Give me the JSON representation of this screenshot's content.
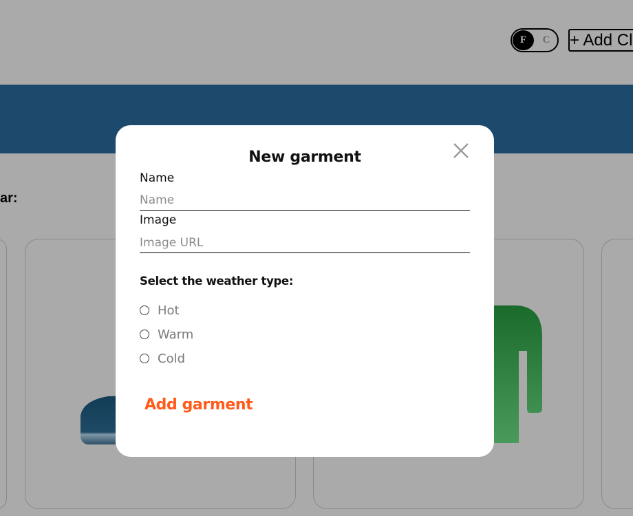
{
  "header": {
    "temp_toggle": {
      "option_f": "F",
      "option_c": "C",
      "selected": "F"
    },
    "add_clothes_label": "+ Add Clothes"
  },
  "main": {
    "weather_text": "ar:"
  },
  "modal": {
    "title": "New garment",
    "name_label": "Name",
    "name_placeholder": "Name",
    "name_value": "",
    "image_label": "Image",
    "image_placeholder": "Image URL",
    "image_value": "",
    "weather_legend": "Select the weather type:",
    "weather_options": [
      "Hot",
      "Warm",
      "Cold"
    ],
    "submit_label": "Add garment",
    "close_icon": "close-icon"
  },
  "colors": {
    "overlay_background": "#aaaaaa",
    "banner": "#1d4a6c",
    "accent": "#ff5b1a",
    "modal_background": "#ffffff"
  }
}
